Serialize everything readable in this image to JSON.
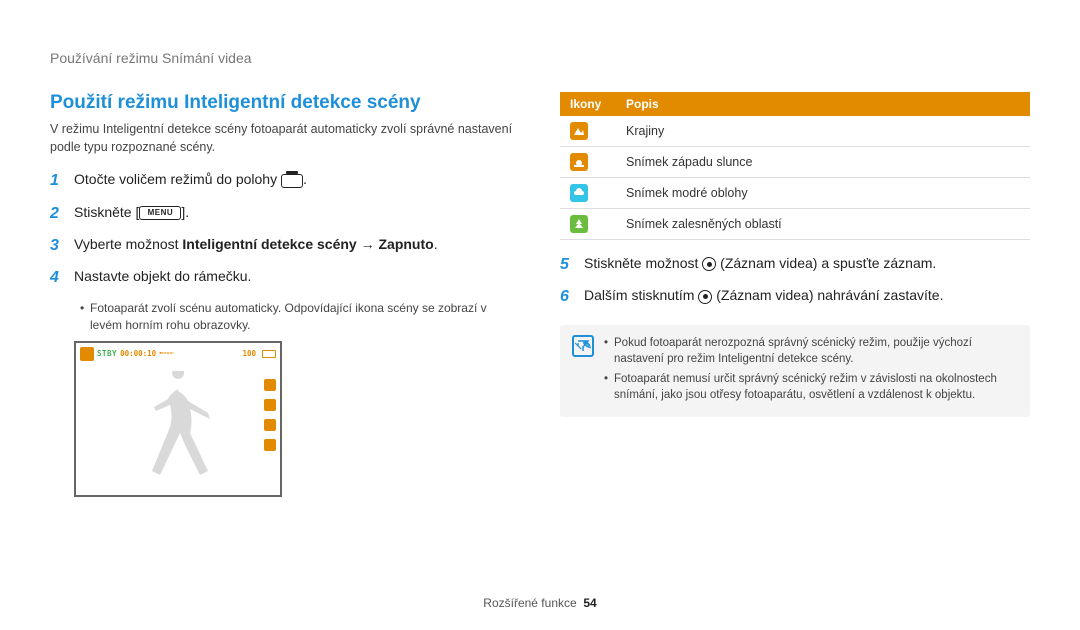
{
  "breadcrumb": "Používání režimu Snímání videa",
  "section_title": "Použití režimu Inteligentní detekce scény",
  "intro": "V režimu Inteligentní detekce scény fotoaparát automaticky zvolí správné nastavení podle typu rozpoznané scény.",
  "steps": [
    {
      "n": "1",
      "pre": "Otočte voličem režimů do polohy ",
      "icon": "video",
      "post": "."
    },
    {
      "n": "2",
      "pre": "Stiskněte [",
      "icon": "menu",
      "post": "]."
    },
    {
      "n": "3",
      "pre": "Vyberte možnost ",
      "bold": "Inteligentní detekce scény → Zapnuto",
      "post": "."
    },
    {
      "n": "4",
      "pre": "Nastavte objekt do rámečku."
    }
  ],
  "step4_sub": "Fotoaparát zvolí scénu automaticky. Odpovídající ikona scény se zobrazí v levém horním rohu obrazovky.",
  "camera": {
    "stby": "STBY",
    "time": "00:00:10",
    "dots": "▪▫▫▫▫▫▫▫▫",
    "num": "100"
  },
  "table": {
    "headers": [
      "Ikony",
      "Popis"
    ],
    "rows": [
      {
        "color": "#E38B00",
        "shape": "mountain",
        "label": "Krajiny"
      },
      {
        "color": "#E38B00",
        "shape": "sunset",
        "label": "Snímek západu slunce"
      },
      {
        "color": "#33C5E8",
        "shape": "cloud",
        "label": "Snímek modré oblohy"
      },
      {
        "color": "#6BBE3D",
        "shape": "tree",
        "label": "Snímek zalesněných oblastí"
      }
    ]
  },
  "steps_right": [
    {
      "n": "5",
      "pre": "Stiskněte možnost ",
      "icon": "rec",
      "post": " (Záznam videa) a spusťte záznam."
    },
    {
      "n": "6",
      "pre": "Dalším stisknutím ",
      "icon": "rec",
      "post": " (Záznam videa) nahrávání zastavíte."
    }
  ],
  "notes": [
    "Pokud fotoaparát nerozpozná správný scénický režim, použije výchozí nastavení pro režim Inteligentní detekce scény.",
    "Fotoaparát nemusí určit správný scénický režim v závislosti na okolnostech snímání, jako jsou otřesy fotoaparátu, osvětlení a vzdálenost k objektu."
  ],
  "menu_label": "MENU",
  "footer": {
    "section": "Rozšířené funkce",
    "page": "54"
  }
}
